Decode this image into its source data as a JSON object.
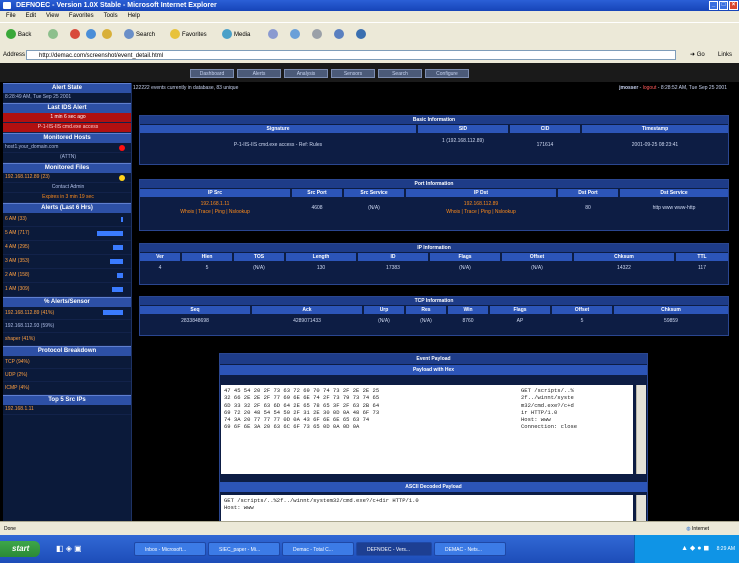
{
  "window": {
    "title": "DEFNOEC - Version 1.0X Stable - Microsoft Internet Explorer"
  },
  "menu": [
    "File",
    "Edit",
    "View",
    "Favorites",
    "Tools",
    "Help"
  ],
  "toolbar": {
    "back": "Back",
    "search": "Search",
    "favorites": "Favorites",
    "media": "Media"
  },
  "address": {
    "label": "Address",
    "value": "http://demac.com/screenshot/event_detail.html",
    "go": "Go",
    "links": "Links"
  },
  "nav": {
    "tabs": [
      "Dashboard",
      "Alerts",
      "Analysis",
      "Sensors",
      "Search",
      "Configure"
    ]
  },
  "sidebar": {
    "sections": [
      {
        "title": "Alert State",
        "rows": [
          {
            "text": "8:28:49 AM, Tue Sep 25 2001",
            "style": ""
          }
        ]
      },
      {
        "title": "Last IDS Alert",
        "rows": [
          {
            "text": "1 min 6 sec ago",
            "style": "red"
          },
          {
            "text": "P-1-IIS-IIS cmd.exe access",
            "style": "red"
          }
        ]
      },
      {
        "title": "Monitored Hosts",
        "rows": [
          {
            "text": "host1.your_domain.com",
            "style": ""
          },
          {
            "text": "(ATTN)",
            "style": ""
          }
        ]
      },
      {
        "title": "Monitored Files",
        "rows": [
          {
            "text": "192.168.112.89 (23)",
            "style": "orange"
          },
          {
            "text": "Contact Admin",
            "style": ""
          },
          {
            "text": "Expires in 3 min 19 sec",
            "style": ""
          }
        ]
      },
      {
        "title": "Alerts (Last 6 Hrs)",
        "rows": [
          {
            "text": "6 AM (33)",
            "style": "orange"
          },
          {
            "text": "5 AM (717)",
            "style": "orange"
          },
          {
            "text": "4 AM (295)",
            "style": "orange"
          },
          {
            "text": "3 AM (353)",
            "style": "orange"
          },
          {
            "text": "2 AM (158)",
            "style": "orange"
          },
          {
            "text": "1 AM (309)",
            "style": "orange"
          }
        ]
      },
      {
        "title": "% Alerts/Sensor",
        "rows": [
          {
            "text": "192.168.112.89 (41%)",
            "style": "orange"
          },
          {
            "text": "192.168.112.93 (59%)",
            "style": ""
          },
          {
            "text": "shaper (41%)",
            "style": "orange"
          }
        ]
      },
      {
        "title": "Protocol Breakdown",
        "rows": [
          {
            "text": "TCP (94%)",
            "style": "orange"
          },
          {
            "text": "UDP (2%)",
            "style": "orange"
          },
          {
            "text": "ICMP (4%)",
            "style": "orange"
          }
        ]
      },
      {
        "title": "Top 5 Src IPs",
        "rows": [
          {
            "text": "192.168.1.11",
            "style": "orange"
          }
        ]
      }
    ]
  },
  "topline": {
    "left": "122222 events currently in database, 83 unique",
    "user": "jmosser",
    "logout": "logout",
    "time": "8:28:52 AM, Tue Sep 25 2001"
  },
  "basic": {
    "title": "Basic Information",
    "headers": [
      "Signature",
      "SID",
      "CID",
      "Timestamp"
    ],
    "signature": "P-1-IIS-IIS cmd.exe access",
    "sig_link": "Ref: Rules",
    "sid": "1 (192.168.112.89)",
    "cid": "171614",
    "timestamp": "2001-09-25 08:23:41"
  },
  "port": {
    "title": "Port Information",
    "headers": [
      "IP Src",
      "Src Port",
      "Src Service",
      "IP Dst",
      "Dst Port",
      "Dst Service"
    ],
    "ip_src": "192.168.1.11",
    "src_links": "Whois | Trace | Ping | Nslookup",
    "src_port": "4608",
    "src_service": "(N/A)",
    "ip_dst": "192.168.112.89",
    "dst_links": "Whois | Trace | Ping | Nslookup",
    "dst_port": "80",
    "dst_service": "http www www-http"
  },
  "ip": {
    "title": "IP Information",
    "headers": [
      "Ver",
      "Hlen",
      "TOS",
      "Length",
      "ID",
      "Flags",
      "Offset",
      "Chksum",
      "TTL"
    ],
    "values": [
      "4",
      "5",
      "(N/A)",
      "130",
      "17383",
      "(N/A)",
      "(N/A)",
      "14322",
      "117"
    ]
  },
  "tcp": {
    "title": "TCP Information",
    "headers": [
      "Seq",
      "Ack",
      "Urp",
      "Res",
      "Win",
      "Flags",
      "Offset",
      "Chksum"
    ],
    "values": [
      "2833848698",
      "4289071433",
      "(N/A)",
      "(N/A)",
      "8760",
      "AP",
      "5",
      "59859"
    ]
  },
  "payload": {
    "title": "Event Payload",
    "subtitle": "Payload with Hex",
    "hex_lines": [
      "47 45 54 20 2F 73 63 72 69 70 74 73 2F 2E 2E 25",
      "32 66 2E 2E 2F 77 69 6E 6E 74 2F 73 79 73 74 65",
      "6D 33 32 2F 63 6D 64 2E 65 78 65 3F 2F 63 2B 64",
      "69 72 20 48 54 54 50 2F 31 2E 30 0D 0A 48 6F 73",
      "74 3A 20 77 77 77 0D 0A 43 6F 6E 6E 65 63 74",
      "69 6F 6E 3A 20 63 6C 6F 73 65 0D 0A 0D 0A"
    ],
    "ascii_lines": [
      "GET /scripts/..%",
      "2f../winnt/syste",
      "m32/cmd.exe?/c+d",
      "ir HTTP/1.0",
      "Host: www",
      "Connection: close"
    ],
    "decoded_title": "ASCII Decoded Payload",
    "decoded_lines": [
      "GET /scripts/..%2f../winnt/system32/cmd.exe?/c+dir HTTP/1.0",
      "Host: www"
    ]
  },
  "status": {
    "left": "Done",
    "right": "Internet"
  },
  "taskbar": {
    "start": "start",
    "tasks": [
      "Inbox - Microsoft...",
      "SIEC_paper - Mi...",
      "Demac - Total C...",
      "DEFNOEC - Vers...",
      "DEMAC - Nets..."
    ],
    "clock": "8:29 AM"
  }
}
